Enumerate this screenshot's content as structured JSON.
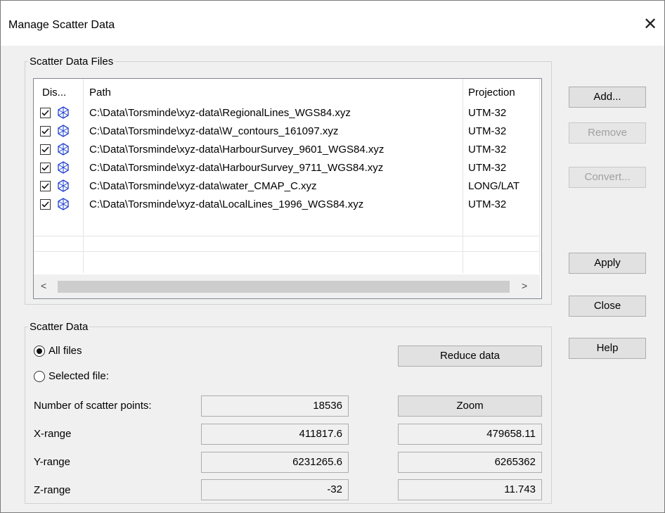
{
  "window": {
    "title": "Manage Scatter Data",
    "close_glyph": "✕"
  },
  "files_group": {
    "legend": "Scatter Data Files",
    "columns": {
      "display": "Dis...",
      "path": "Path",
      "projection": "Projection"
    },
    "rows": [
      {
        "checked": true,
        "path": "C:\\Data\\Torsminde\\xyz-data\\RegionalLines_WGS84.xyz",
        "projection": "UTM-32"
      },
      {
        "checked": true,
        "path": "C:\\Data\\Torsminde\\xyz-data\\W_contours_161097.xyz",
        "projection": "UTM-32"
      },
      {
        "checked": true,
        "path": "C:\\Data\\Torsminde\\xyz-data\\HarbourSurvey_9601_WGS84.xyz",
        "projection": "UTM-32"
      },
      {
        "checked": true,
        "path": "C:\\Data\\Torsminde\\xyz-data\\HarbourSurvey_9711_WGS84.xyz",
        "projection": "UTM-32"
      },
      {
        "checked": true,
        "path": "C:\\Data\\Torsminde\\xyz-data\\water_CMAP_C.xyz",
        "projection": "LONG/LAT"
      },
      {
        "checked": true,
        "path": "C:\\Data\\Torsminde\\xyz-data\\LocalLines_1996_WGS84.xyz",
        "projection": "UTM-32"
      }
    ],
    "scroll_left": "<",
    "scroll_right": ">"
  },
  "side_buttons": {
    "add": "Add...",
    "remove": "Remove",
    "convert": "Convert...",
    "apply": "Apply",
    "close": "Close",
    "help": "Help"
  },
  "scatter_group": {
    "legend": "Scatter Data",
    "all_files": "All files",
    "selected_file": "Selected file:",
    "selected_option": "all_files",
    "reduce_button": "Reduce data",
    "zoom_button": "Zoom",
    "num_points_label": "Number of scatter points:",
    "num_points": "18536",
    "x_label": "X-range",
    "x_min": "411817.6",
    "x_max": "479658.11",
    "y_label": "Y-range",
    "y_min": "6231265.6",
    "y_max": "6265362",
    "z_label": "Z-range",
    "z_min": "-32",
    "z_max": "11.743"
  },
  "icons": {
    "row_icon": "scatter-data-icon",
    "checkbox": "checkbox-checked-icon"
  },
  "colors": {
    "icon_blue": "#1f3fd0",
    "window_bg": "#f0f0f0"
  }
}
